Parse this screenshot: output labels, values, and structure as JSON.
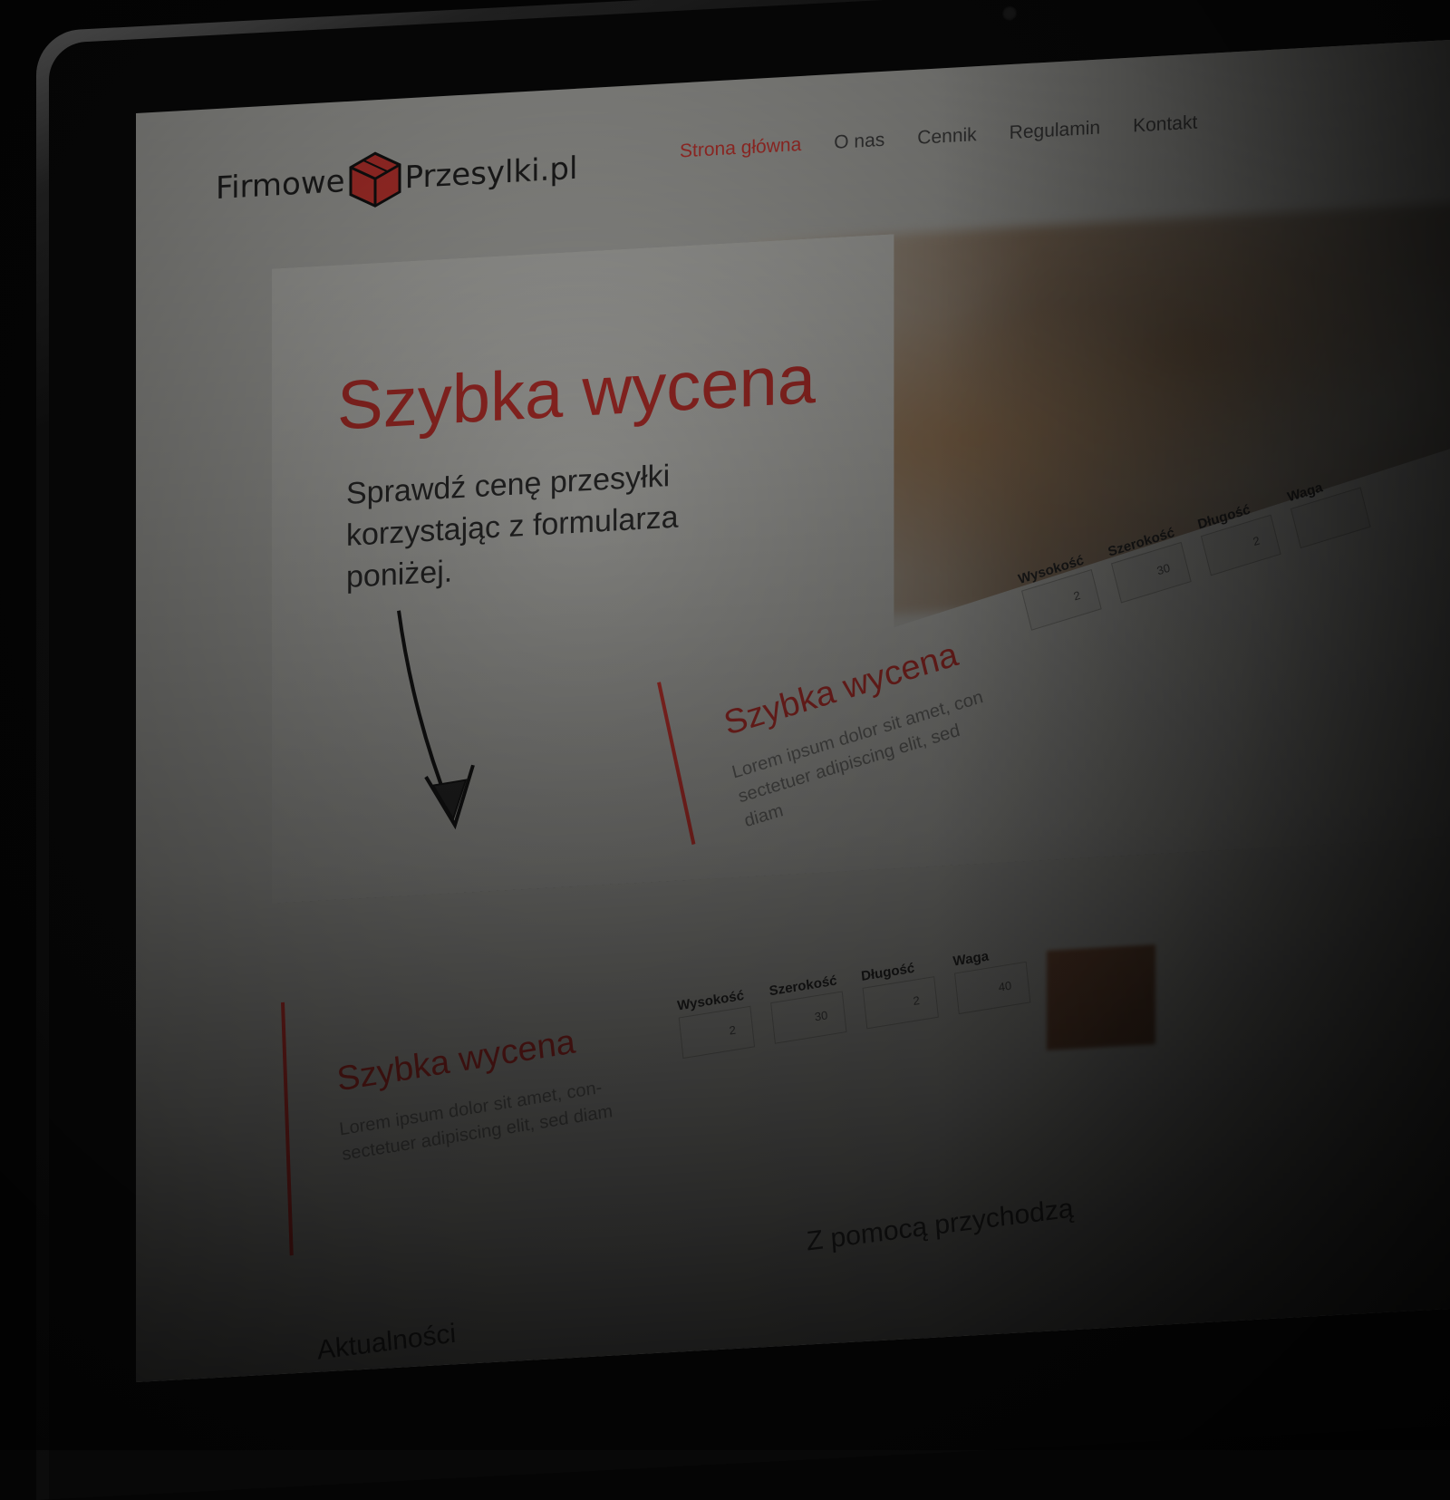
{
  "logo": {
    "left_text": "Firmowe",
    "right_text": "Przesylki.pl"
  },
  "nav": {
    "items": [
      {
        "label": "Strona główna",
        "active": true
      },
      {
        "label": "O nas",
        "active": false
      },
      {
        "label": "Cennik",
        "active": false
      },
      {
        "label": "Regulamin",
        "active": false
      },
      {
        "label": "Kontakt",
        "active": false
      }
    ]
  },
  "hero": {
    "title": "Szybka wycena",
    "subtitle": "Sprawdź cenę przesyłki korzystając z formularza poniżej."
  },
  "quote_panel_1": {
    "title": "Szybka wycena",
    "desc": "Lorem ipsum dolor sit amet, con sectetuer adipiscing elit, sed diam",
    "fields": [
      {
        "label": "Wysokość",
        "value": "2"
      },
      {
        "label": "Szerokość",
        "value": "30"
      },
      {
        "label": "Długość",
        "value": "2"
      },
      {
        "label": "Waga",
        "value": ""
      }
    ]
  },
  "quote_panel_2": {
    "title": "Szybka wycena",
    "desc": "Lorem ipsum dolor sit amet, con- sectetuer adipiscing elit, sed diam",
    "fields": [
      {
        "label": "Wysokość",
        "value": "2"
      },
      {
        "label": "Szerokość",
        "value": "30"
      },
      {
        "label": "Długość",
        "value": "2"
      },
      {
        "label": "Waga",
        "value": "40"
      }
    ]
  },
  "bottom_title": "Z pomocą przychodzą",
  "bottom_left": "Aktualności",
  "colors": {
    "accent": "#b5312c",
    "text": "#262626"
  }
}
